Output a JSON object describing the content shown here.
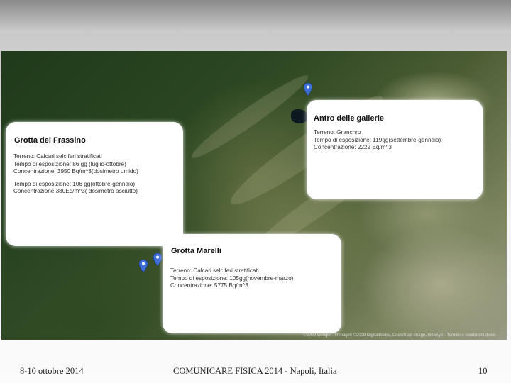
{
  "map": {
    "credit": "©2009 Google - Immagini ©2009 DigitalGlobe, Cnes/Spot Image, GeoEye - Termini e condizioni d'uso"
  },
  "cards": {
    "frassino": {
      "title": "Grotta del Frassino",
      "lines": [
        "Terreno: Calcari selciferi stratificati",
        "Tempo di esposizione: 86 gg (luglio-ottobre)",
        "Concentrazione: 3950 Bq/m^3(dosimetro umido)"
      ],
      "lines2": [
        "Tempo di esposizione: 106 gg(ottobre-gennaio)",
        "Concentrazione 380Eq/m^3( dosimetro asciutto)"
      ]
    },
    "antro": {
      "title": "Antro delle gallerie",
      "lines": [
        "Terreno: Granchro",
        "Tempo di esposizione: 119gg(settembre-gennaio)",
        "Concentrazione: 2222 Eq/m^3"
      ]
    },
    "marelli": {
      "title": "Grotta Marelli",
      "lines": [
        "Terreno: Calcari selciferi stratificati",
        "Tempo di esposizione: 105gg(novembre-marzo)",
        "Concentrazione: 5775 Bq/m^3"
      ]
    }
  },
  "pin_color": "#3f6fd8",
  "footer": {
    "date": "8-10 ottobre 2014",
    "title": "COMUNICARE FISICA 2014 - Napoli, Italia",
    "page": "10"
  }
}
